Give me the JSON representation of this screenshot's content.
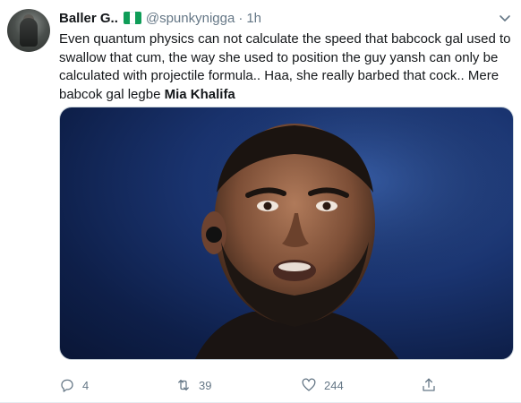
{
  "tweet": {
    "name": "Baller G..",
    "handle": "@spunkynigga",
    "separator": "·",
    "time": "1h",
    "text_plain": "Even quantum physics can not calculate the speed that babcock gal used to swallow that cum, the way she used to position the guy yansh can only be calculated with projectile formula.. Haa, she really barbed that cock.. Mere babcok gal legbe ",
    "text_bold": "Mia Khalifa",
    "colors": {
      "flag_green": "#0f9d58",
      "meta_gray": "#657786",
      "text": "#14171a"
    }
  },
  "icons": {
    "more": "chevron-down-icon",
    "reply": "reply-icon",
    "retweet": "retweet-icon",
    "like": "heart-icon",
    "share": "share-icon"
  },
  "actions": {
    "reply_count": "4",
    "retweet_count": "39",
    "like_count": "244"
  }
}
